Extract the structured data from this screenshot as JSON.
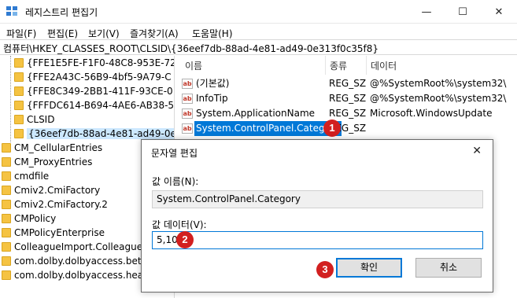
{
  "window": {
    "title": "레지스트리 편집기",
    "minimize_glyph": "—",
    "maximize_glyph": "☐",
    "close_glyph": "✕"
  },
  "menu": [
    "파일(F)",
    "편집(E)",
    "보기(V)",
    "즐겨찾기(A)",
    "도움말(H)"
  ],
  "address": "컴퓨터\\HKEY_CLASSES_ROOT\\CLSID\\{36eef7db-88ad-4e81-ad49-0e313f0c35f8}",
  "tree": {
    "items": [
      "{FFE1E5FE-F1F0-48C8-953E-72",
      "{FFE2A43C-56B9-4bf5-9A79-C",
      "{FFE8C349-2BB1-411F-93CE-0",
      "{FFFDC614-B694-4AE6-AB38-5",
      "CLSID",
      "{36eef7db-88ad-4e81-ad49-0e",
      "CM_CellularEntries",
      "CM_ProxyEntries",
      "cmdfile",
      "Cmiv2.CmiFactory",
      "Cmiv2.CmiFactory.2",
      "CMPolicy",
      "CMPolicyEnterprise",
      "ColleagueImport.ColleagueImp",
      "com.dolby.dolbyaccess.beta",
      "com.dolby.dolbyaccess.headph"
    ],
    "selected_index": 5
  },
  "list": {
    "headers": {
      "name": "이름",
      "type": "종류",
      "data": "데이터"
    },
    "rows": [
      {
        "name": "(기본값)",
        "type": "REG_SZ",
        "data": "@%SystemRoot%\\system32\\"
      },
      {
        "name": "InfoTip",
        "type": "REG_SZ",
        "data": "@%SystemRoot%\\system32\\"
      },
      {
        "name": "System.ApplicationName",
        "type": "REG_SZ",
        "data": "Microsoft.WindowsUpdate"
      },
      {
        "name": "System.ControlPanel.Category",
        "type": "REG_SZ",
        "data": ""
      }
    ],
    "selected_index": 3,
    "icon_text": "ab"
  },
  "dialog": {
    "title": "문자열 편집",
    "close_glyph": "✕",
    "value_name_label": "값 이름(N):",
    "value_name": "System.ControlPanel.Category",
    "value_data_label": "값 데이터(V):",
    "value_data": "5,10",
    "ok_label": "확인",
    "cancel_label": "취소"
  },
  "markers": [
    "1",
    "2",
    "3"
  ],
  "colors": {
    "accent": "#0078d7",
    "marker": "#d21f1f",
    "selection_tree": "#cce8ff",
    "folder": "#f5c342"
  }
}
